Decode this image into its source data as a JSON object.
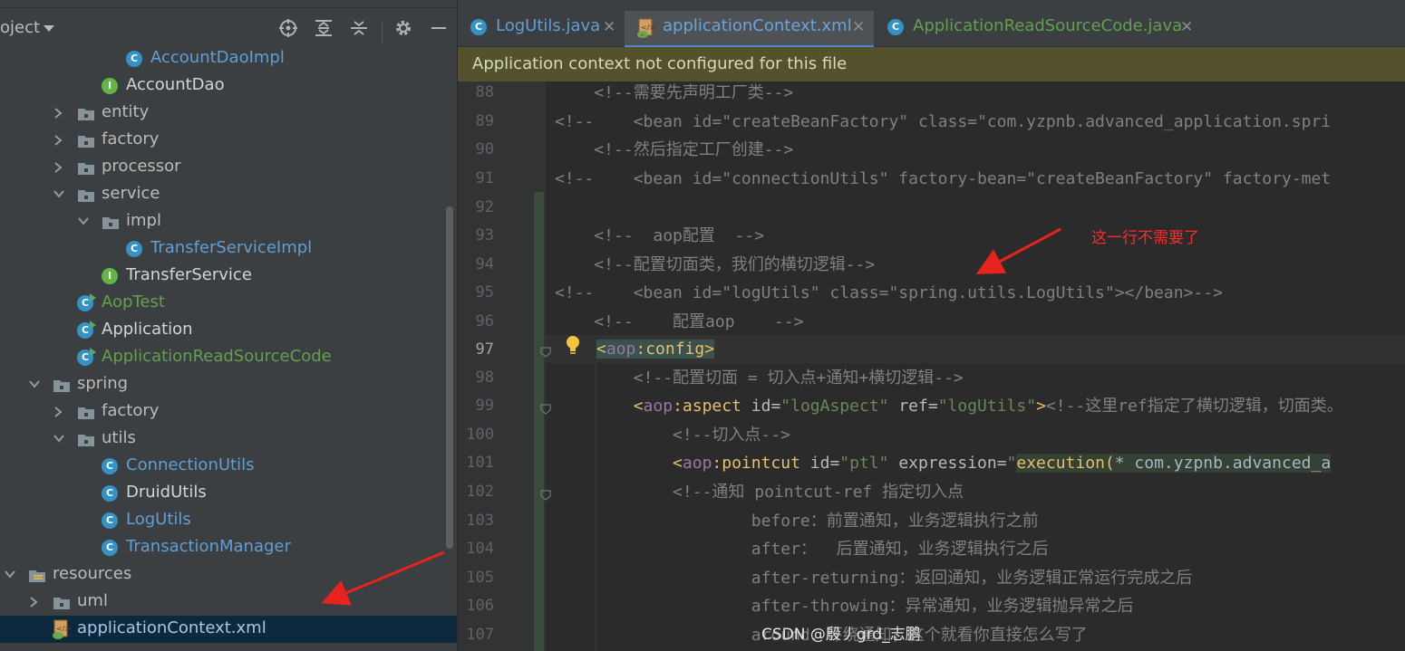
{
  "project_panel": {
    "title": "oject",
    "toolbar_icons": [
      "locate-icon",
      "expand-all-icon",
      "collapse-all-icon",
      "gear-icon",
      "minimize-icon"
    ],
    "tree": [
      {
        "label": "AccountDaoImpl",
        "kind": "class",
        "color": "blue"
      },
      {
        "label": "AccountDao",
        "kind": "interface",
        "color": "white"
      },
      {
        "label": "entity",
        "kind": "folder",
        "expanded": false
      },
      {
        "label": "factory",
        "kind": "folder",
        "expanded": false
      },
      {
        "label": "processor",
        "kind": "folder",
        "expanded": false
      },
      {
        "label": "service",
        "kind": "folder",
        "expanded": true
      },
      {
        "label": "impl",
        "kind": "folder",
        "expanded": true
      },
      {
        "label": "TransferServiceImpl",
        "kind": "class",
        "color": "blue"
      },
      {
        "label": "TransferService",
        "kind": "interface",
        "color": "white"
      },
      {
        "label": "AopTest",
        "kind": "class-run",
        "color": "green"
      },
      {
        "label": "Application",
        "kind": "class-run",
        "color": "white"
      },
      {
        "label": "ApplicationReadSourceCode",
        "kind": "class-run",
        "color": "green"
      },
      {
        "label": "spring",
        "kind": "folder",
        "expanded": true
      },
      {
        "label": "factory",
        "kind": "folder",
        "expanded": false
      },
      {
        "label": "utils",
        "kind": "folder",
        "expanded": true
      },
      {
        "label": "ConnectionUtils",
        "kind": "class",
        "color": "blue"
      },
      {
        "label": "DruidUtils",
        "kind": "class",
        "color": "white"
      },
      {
        "label": "LogUtils",
        "kind": "class",
        "color": "blue"
      },
      {
        "label": "TransactionManager",
        "kind": "class",
        "color": "blue"
      },
      {
        "label": "resources",
        "kind": "resources-folder",
        "expanded": true
      },
      {
        "label": "uml",
        "kind": "folder",
        "expanded": false
      },
      {
        "label": "applicationContext.xml",
        "kind": "xml",
        "selected": true
      }
    ]
  },
  "tabs": [
    {
      "label": "LogUtils.java",
      "active": false,
      "icon": "class-icon"
    },
    {
      "label": "applicationContext.xml",
      "active": true,
      "icon": "xml-icon"
    },
    {
      "label": "ApplicationReadSourceCode.java",
      "active": false,
      "icon": "class-run-icon"
    }
  ],
  "notice": "Application context not configured for this file",
  "line_numbers": [
    "88",
    "89",
    "90",
    "91",
    "92",
    "93",
    "94",
    "95",
    "96",
    "97",
    "98",
    "99",
    "100",
    "101",
    "102",
    "103",
    "104",
    "105",
    "106",
    "107"
  ],
  "current_line": "97",
  "code": {
    "l88": "    <!--需要先声明工厂类-->",
    "l89_a": "<!--    <bean id=\"createBeanFactory\" class=\"com.yzpnb.advanced_application.spri",
    "l90": "    <!--然后指定工厂创建-->",
    "l91": "<!--    <bean id=\"connectionUtils\" factory-bean=\"createBeanFactory\" factory-met",
    "l93": "    <!--  aop配置  -->",
    "l94": "    <!--配置切面类，我们的横切逻辑-->",
    "l95": "<!--    <bean id=\"logUtils\" class=\"spring.utils.LogUtils\"></bean>-->",
    "l96": "    <!--    配置aop    -->",
    "l97_open": "<",
    "l97_ns": "aop",
    "l97_tag": ":config",
    "l97_close": ">",
    "l98": "        <!--配置切面 = 切入点+通知+横切逻辑-->",
    "l99_lt": "        <",
    "l99_ns": "aop",
    "l99_tag": ":aspect ",
    "l99_attr1": "id=",
    "l99_val1": "\"logAspect\"",
    "l99_attr2": " ref=",
    "l99_val2": "\"logUtils\"",
    "l99_gt": ">",
    "l99_cm": "<!--这里ref指定了横切逻辑，切面类。",
    "l100": "            <!--切入点-->",
    "l101_lt": "            <",
    "l101_ns": "aop",
    "l101_tag": ":pointcut ",
    "l101_attr1": "id=",
    "l101_val1": "\"ptl\"",
    "l101_attr2": " expression=",
    "l101_q": "\"",
    "l101_expr_a": "execution(",
    "l101_expr_b": "* com.yzpnb.advanced_a",
    "l102": "            <!--通知 pointcut-ref 指定切入点",
    "l103": "                    before：前置通知，业务逻辑执行之前",
    "l104": "                    after：  后置通知，业务逻辑执行之后",
    "l105": "                    after-returning：返回通知，业务逻辑正常运行完成之后",
    "l106": "                    after-throwing：异常通知，业务逻辑抛异常之后",
    "l107": "                    around：环绕通知，这个就看你直接怎么写了"
  },
  "annotation": "这一行不需要了",
  "watermark": "CSDN @殷丿grd_志鹏",
  "colors": {
    "annotation": "#ff2a2a",
    "selection": "#0d293e",
    "tab_underline": "#4a88c7"
  }
}
